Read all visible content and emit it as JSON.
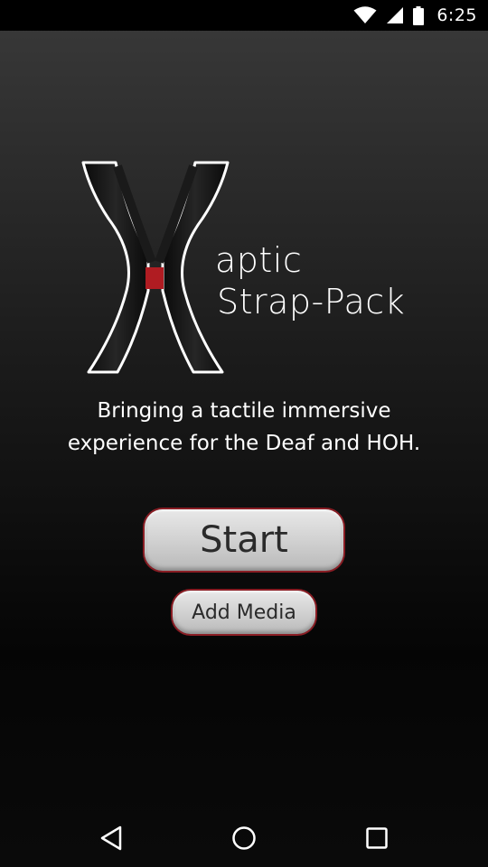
{
  "status_bar": {
    "time": "6:25",
    "icons": [
      "wifi-icon",
      "cell-signal-icon",
      "battery-icon"
    ]
  },
  "logo": {
    "line1": "aptic",
    "line2": "Strap-Pack",
    "accent_color": "#b01c22"
  },
  "tagline": {
    "line1": "Bringing a tactile immersive",
    "line2": "experience for the Deaf and HOH."
  },
  "buttons": {
    "start_label": "Start",
    "add_media_label": "Add Media",
    "border_color": "#8a1d24"
  },
  "nav_bar": {
    "icons": [
      "back-icon",
      "home-icon",
      "recents-icon"
    ]
  }
}
